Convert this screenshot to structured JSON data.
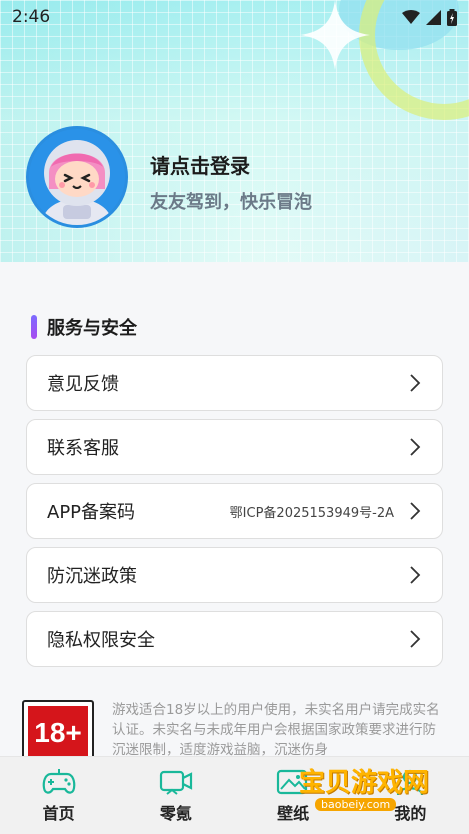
{
  "status_bar": {
    "time": "2:46"
  },
  "profile": {
    "title": "请点击登录",
    "subtitle": "友友驾到，快乐冒泡"
  },
  "section": {
    "title": "服务与安全"
  },
  "menu": [
    {
      "label": "意见反馈",
      "value": ""
    },
    {
      "label": "联系客服",
      "value": ""
    },
    {
      "label": "APP备案码",
      "value": "鄂ICP备2025153949号-2A"
    },
    {
      "label": "防沉迷政策",
      "value": ""
    },
    {
      "label": "隐私权限安全",
      "value": ""
    }
  ],
  "notice": {
    "badge": "18+",
    "text": "游戏适合18岁以上的用户使用，未实名用户请完成实名认证。未实名与未成年用户会根据国家政策要求进行防沉迷限制，适度游戏益脑，沉迷伤身"
  },
  "tabbar": [
    {
      "label": "首页",
      "icon": "gamepad-icon"
    },
    {
      "label": "零氪",
      "icon": "video-icon"
    },
    {
      "label": "壁纸",
      "icon": "image-icon"
    },
    {
      "label": "我的",
      "icon": "user-icon"
    }
  ],
  "watermark": {
    "text": "宝贝游戏网",
    "url": "baobeiy.com"
  },
  "colors": {
    "accent": "#8a5cf6",
    "age_red": "#d5151b",
    "watermark": "#ffb400"
  }
}
